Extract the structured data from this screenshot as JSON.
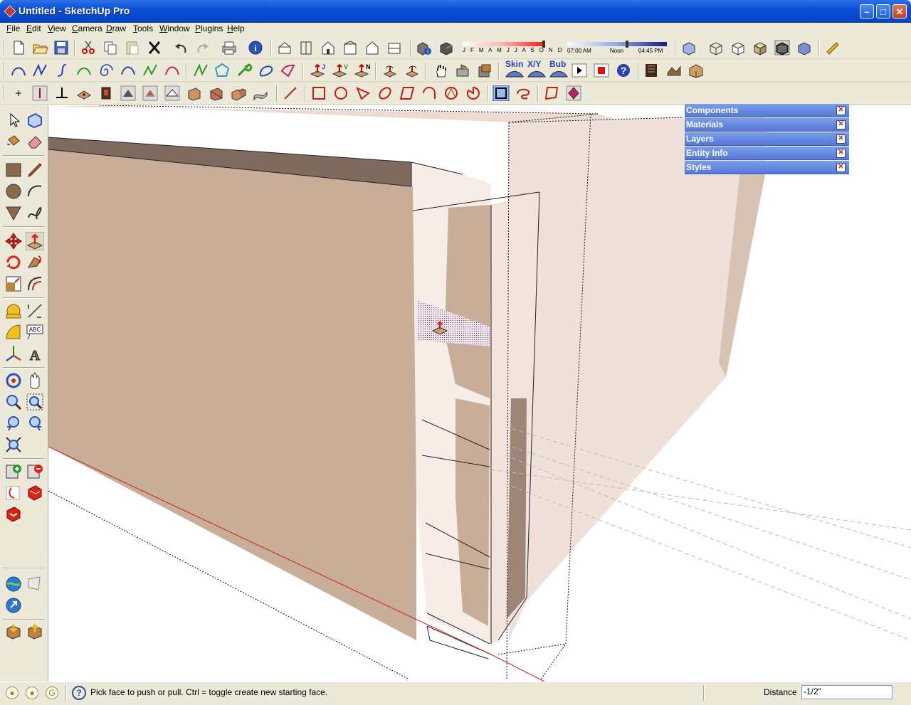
{
  "window": {
    "title": "Untitled - SketchUp Pro",
    "min": "–",
    "max": "□",
    "close": "✕"
  },
  "menu": [
    "File",
    "Edit",
    "View",
    "Camera",
    "Draw",
    "Tools",
    "Window",
    "Plugins",
    "Help"
  ],
  "shadows": {
    "months": "J F M A M J J A S O N D",
    "time_start": "07:00 AM",
    "time_mid": "Noon",
    "time_end": "04:45 PM"
  },
  "plugin_labels": {
    "skin": "Skin",
    "xy": "X/Y",
    "bub": "Bub"
  },
  "trays": [
    "Components",
    "Materials",
    "Layers",
    "Entity Info",
    "Styles"
  ],
  "status": {
    "message": "Pick face to push or pull.  Ctrl = toggle create new starting face.",
    "measure_label": "Distance",
    "measure_value": "-1/2\""
  },
  "colors": {
    "titlebar": "#0a4fd6",
    "tray": "#6a8ce0",
    "face": "#c8ad98",
    "background": "#ece9d8"
  }
}
